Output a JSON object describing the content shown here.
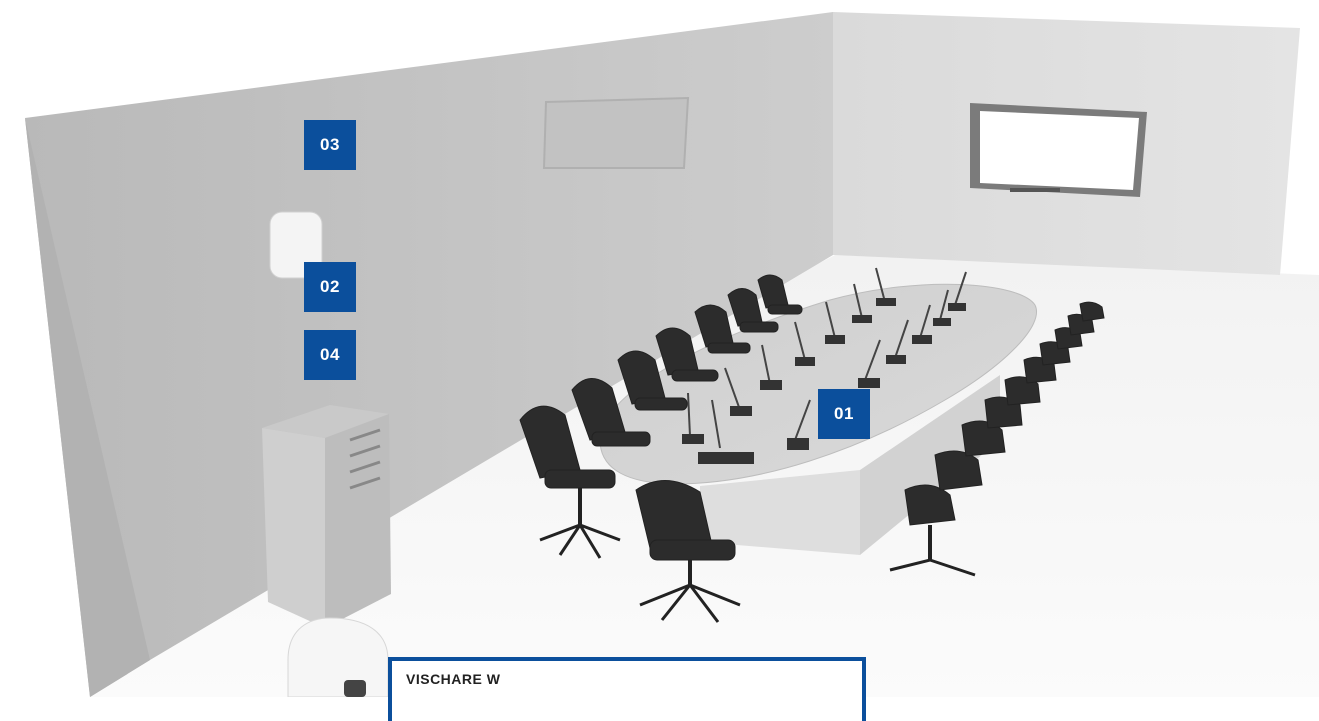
{
  "markers": {
    "m01": {
      "label": "01",
      "color": "#0b4f9c"
    },
    "m02": {
      "label": "02",
      "color": "#0b4f9c"
    },
    "m03": {
      "label": "03",
      "color": "#0b4f9c"
    },
    "m04": {
      "label": "04",
      "color": "#0b4f9c"
    }
  },
  "info_panel": {
    "title": "VISCHARE W",
    "border_color": "#0b4f9c"
  },
  "scene": {
    "objects": [
      "conference-table",
      "office-chairs",
      "gooseneck-microphones",
      "wall-display",
      "speaker-lectern",
      "wall-access-point"
    ]
  }
}
